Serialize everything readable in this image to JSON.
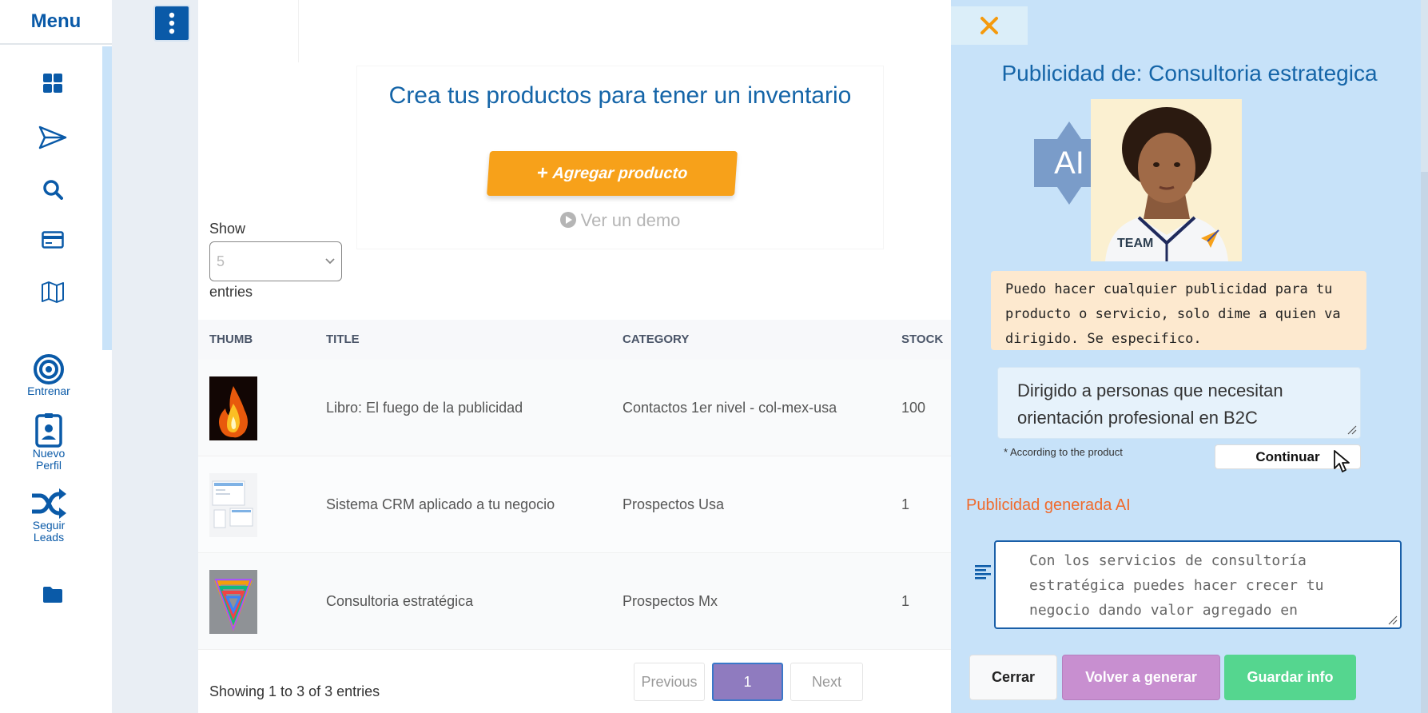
{
  "sidebar": {
    "title": "Menu",
    "items": [
      {
        "icon": "grid-icon"
      },
      {
        "icon": "send-icon"
      },
      {
        "icon": "search-icon"
      },
      {
        "icon": "credit-card-icon"
      },
      {
        "icon": "map-icon"
      },
      {
        "icon": "target-icon",
        "label": "Entrenar"
      },
      {
        "icon": "id-badge-icon",
        "label": "Nuevo Perfil"
      },
      {
        "icon": "shuffle-icon",
        "label": "Seguir Leads"
      },
      {
        "icon": "folder-icon"
      }
    ]
  },
  "main": {
    "promo_title": "Crea tus productos para tener un inventario",
    "add_button": "Agregar producto",
    "demo_link": "Ver un demo",
    "show_label": "Show",
    "page_size": "5",
    "entries_label": "entries",
    "table": {
      "columns": [
        "THUMB",
        "TITLE",
        "CATEGORY",
        "STOCK"
      ],
      "rows": [
        {
          "title": "Libro: El fuego de la publicidad",
          "category": "Contactos 1er nivel - col-mex-usa",
          "stock": "100"
        },
        {
          "title": "Sistema CRM aplicado a tu negocio",
          "category": "Prospectos Usa",
          "stock": "1"
        },
        {
          "title": "Consultoria estratégica",
          "category": "Prospectos Mx",
          "stock": "1"
        }
      ]
    },
    "showing_text": "Showing 1 to 3 of 3 entries",
    "pagination": {
      "previous": "Previous",
      "current": "1",
      "next": "Next"
    }
  },
  "panel": {
    "title": "Publicidad de: Consultoria estrategica",
    "ai_badge": "AI",
    "avatar_shirt_text": "TEAM",
    "assistant_message": "Puedo hacer cualquier publicidad para tu producto o servicio, solo dime a quien va dirigido. Se especifico.",
    "audience_input": "Dirigido a personas que necesitan orientación profesional en B2C",
    "hint": "* According to the product",
    "continue_button": "Continuar",
    "generated_label": "Publicidad generada AI",
    "generated_text": "Con los servicios de consultoría estratégica puedes hacer crecer tu negocio dando valor agregado en",
    "buttons": {
      "close": "Cerrar",
      "regenerate": "Volver a generar",
      "save": "Guardar info"
    }
  },
  "colors": {
    "brand_blue": "#0a5aa8",
    "accent_orange": "#f7a11a",
    "panel_bg": "#c7e2f9",
    "regen_purple": "#c88fd0",
    "save_green": "#55d68f",
    "close_x": "#f59a0d",
    "generated_label": "#f06a2c"
  }
}
